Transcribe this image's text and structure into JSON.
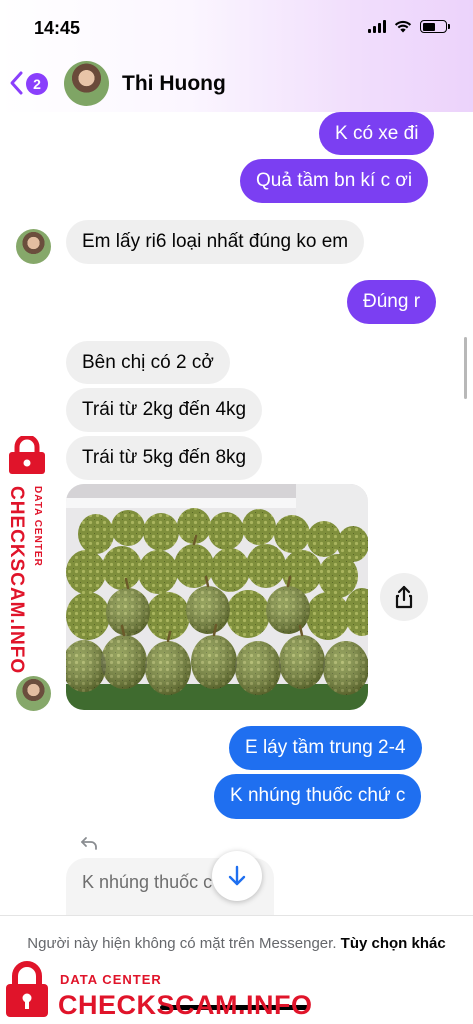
{
  "status_bar": {
    "time": "14:45"
  },
  "header": {
    "unread_count": "2",
    "contact_name": "Thi Huong"
  },
  "messages": {
    "out_1": "K có xe đi",
    "out_2": "Quả tầm bn kí c ơi",
    "in_1": "Em lấy ri6 loại nhất đúng ko em",
    "out_3": "Đúng r",
    "in_2": "Bên chị có 2 cở",
    "in_3": "Trái từ 2kg đến 4kg",
    "in_4": "Trái từ 5kg đến 8kg",
    "out_4": "E láy tầm trung 2-4",
    "out_5": "K nhúng thuốc chứ c",
    "reply_preview": "K nhúng thuốc c"
  },
  "notice": {
    "text": "Người này hiện không có mặt trên Messenger.",
    "link": "Tùy chọn khác"
  },
  "watermark": {
    "small": "DATA CENTER",
    "big": "CHECKSCAM.INFO"
  },
  "colors": {
    "outgoing_purple": "#7b3ff2",
    "outgoing_blue": "#1f6ff0",
    "incoming_gray": "#efefef",
    "watermark_red": "#e0142a"
  }
}
